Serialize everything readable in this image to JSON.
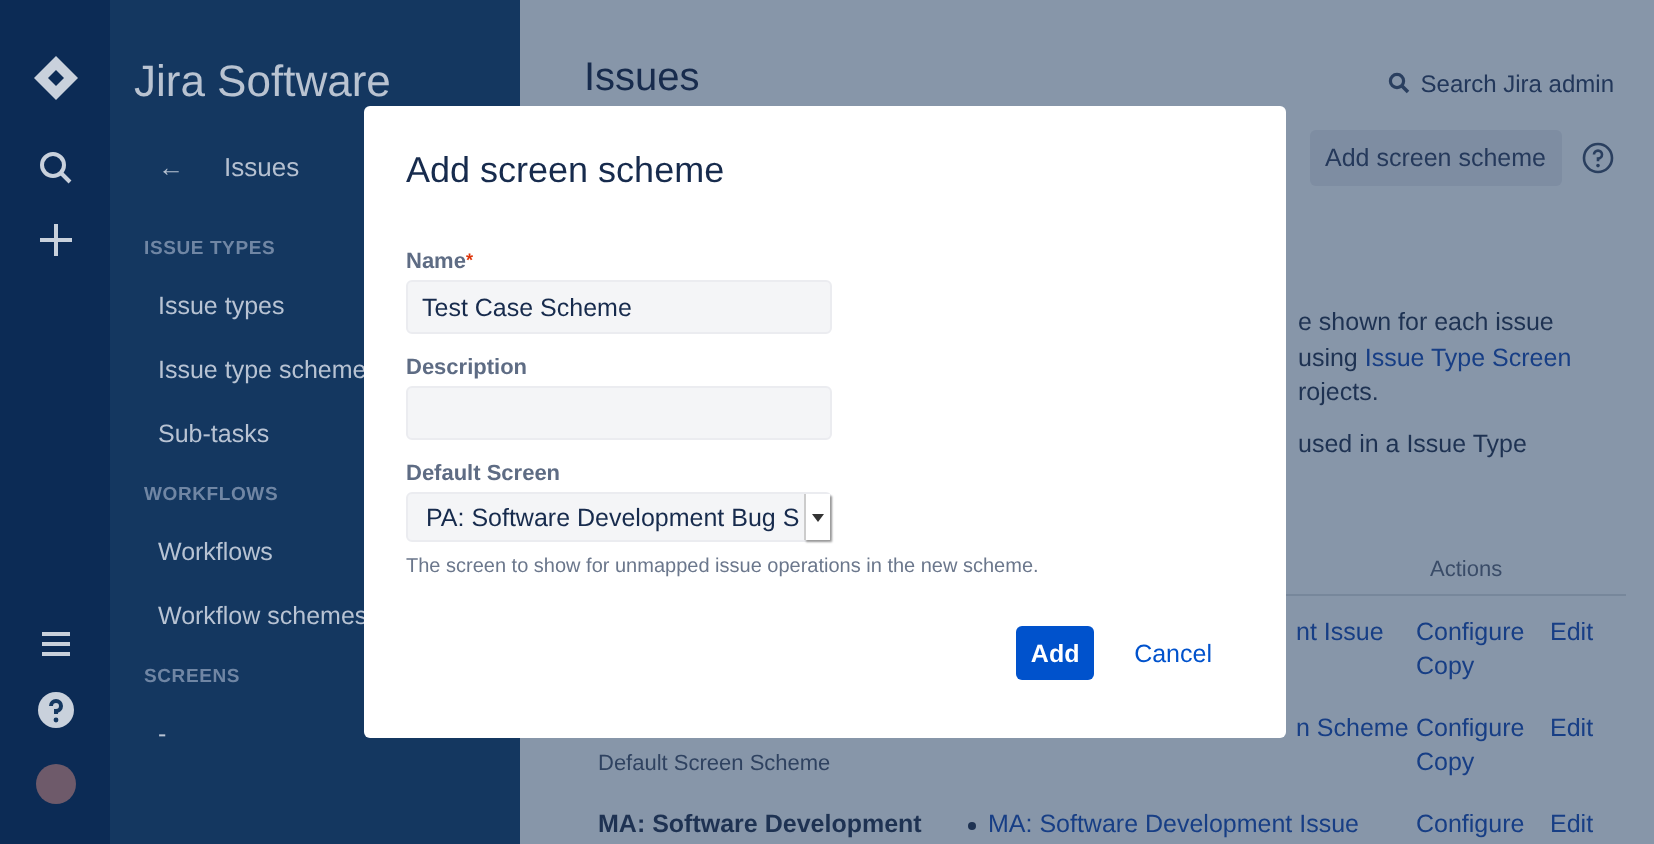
{
  "sidebar": {
    "product": "Jira Software",
    "back": {
      "arrow": "←",
      "label": "Issues"
    },
    "sections": [
      {
        "heading": "ISSUE TYPES",
        "items": [
          "Issue types",
          "Issue type scheme",
          "Sub-tasks"
        ]
      },
      {
        "heading": "WORKFLOWS",
        "items": [
          "Workflows",
          "Workflow schemes"
        ]
      },
      {
        "heading": "SCREENS",
        "items": [
          "-"
        ]
      }
    ]
  },
  "header": {
    "title": "Issues",
    "search": "Search Jira admin",
    "action_button": "Add screen scheme"
  },
  "description": [
    {
      "lines": [
        {
          "parts": [
            {
              "text": "e shown for each issue",
              "link": false
            }
          ]
        },
        {
          "parts": [
            {
              "text": "using ",
              "link": false
            },
            {
              "text": "Issue Type Screen",
              "link": true
            }
          ]
        },
        {
          "parts": [
            {
              "text": "rojects.",
              "link": false
            }
          ]
        }
      ]
    },
    {
      "lines": [
        {
          "parts": [
            {
              "text": "used in a Issue Type",
              "link": false
            }
          ]
        }
      ]
    }
  ],
  "table": {
    "actions_header": "Actions",
    "rows": [
      {
        "screen": "nt Issue",
        "bullet": false,
        "actions": [
          "Configure",
          "Edit",
          "Copy"
        ]
      },
      {
        "note": "Default Screen Scheme",
        "screen": "n Scheme",
        "bullet": false,
        "actions": [
          "Configure",
          "Edit",
          "Copy"
        ]
      },
      {
        "name": "MA: Software Development",
        "screen": "MA: Software Development Issue",
        "bullet": true,
        "actions": [
          "Configure",
          "Edit"
        ]
      }
    ]
  },
  "dialog": {
    "title": "Add screen scheme",
    "fields": [
      {
        "kind": "text",
        "label": "Name",
        "required": true,
        "value": "Test Case Scheme"
      },
      {
        "kind": "text",
        "label": "Description",
        "required": false
      },
      {
        "kind": "select",
        "label": "Default Screen",
        "required": false,
        "value": "PA: Software Development Bug S",
        "help": "The screen to show for unmapped issue operations in the new scheme."
      }
    ],
    "required_mark": "*",
    "primary": "Add",
    "cancel": "Cancel"
  }
}
